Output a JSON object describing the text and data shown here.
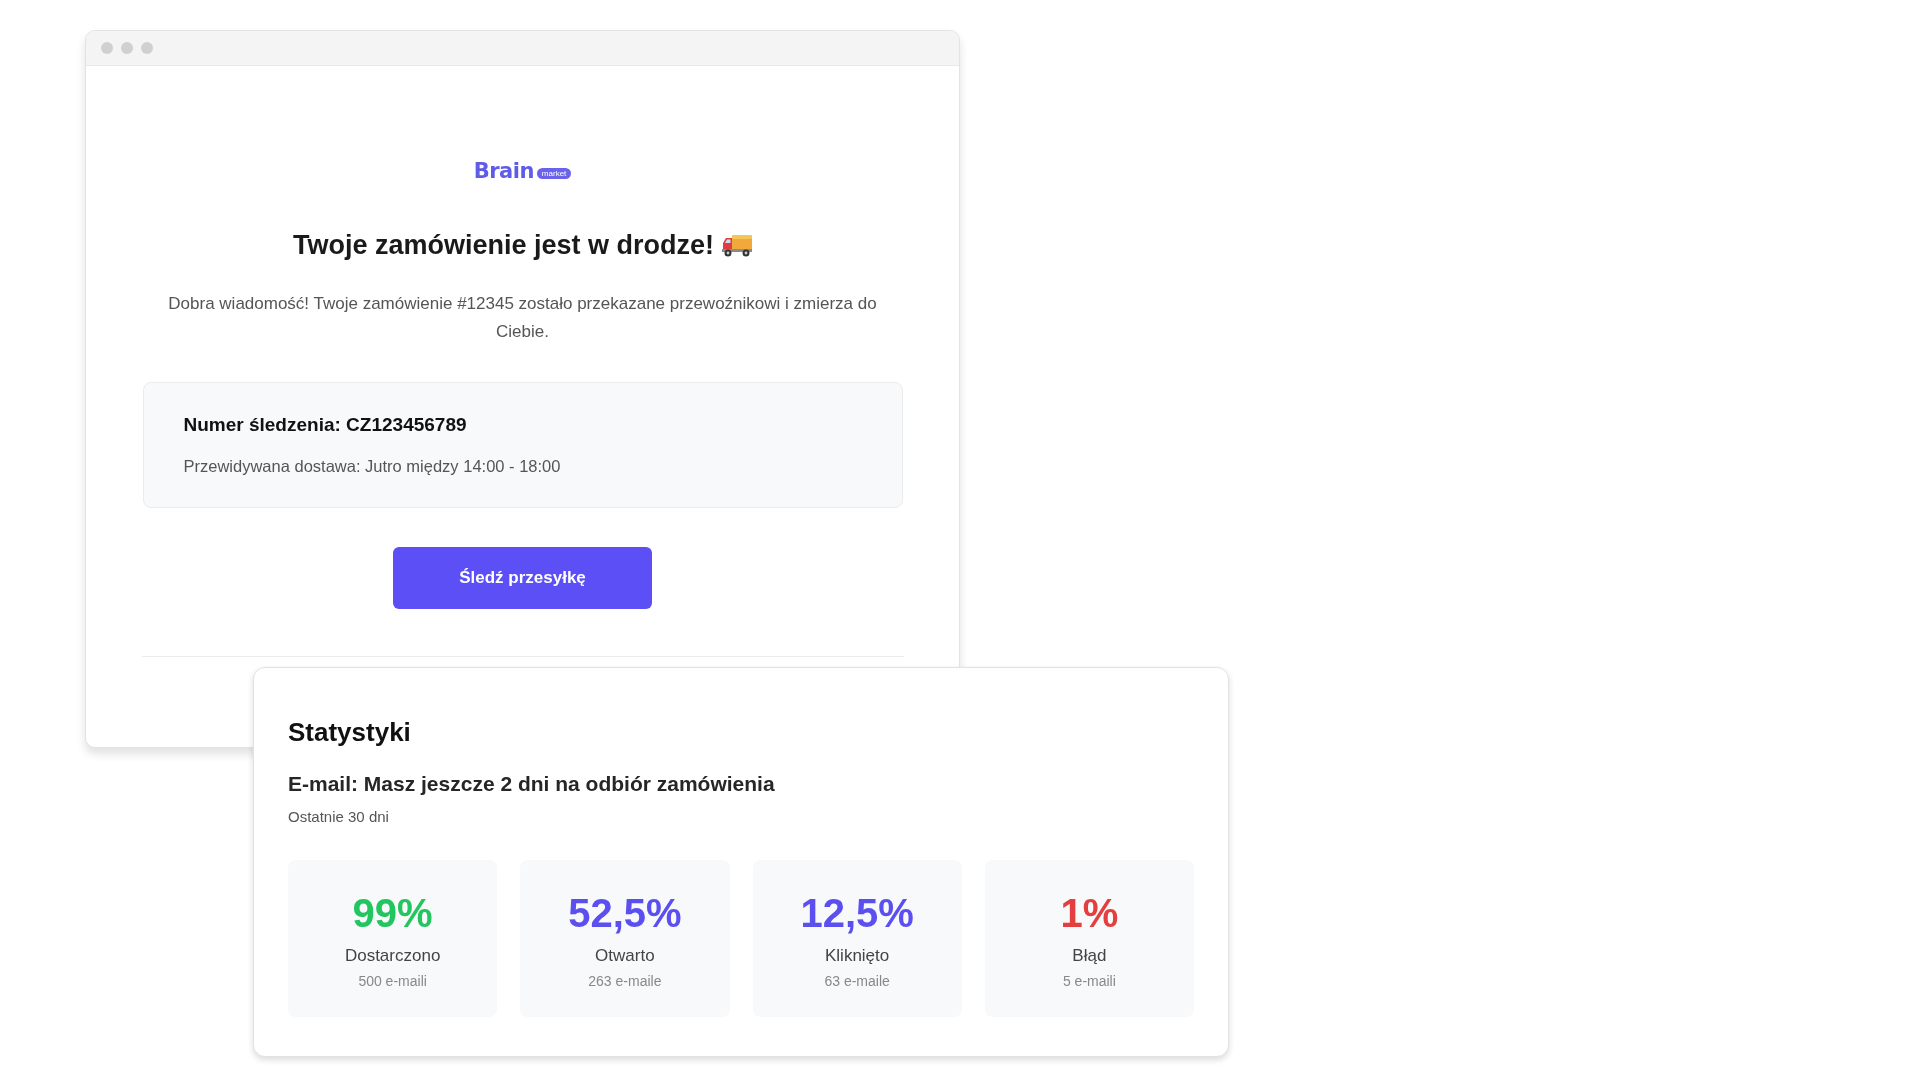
{
  "email": {
    "logo": {
      "name": "Brain",
      "tag": "market"
    },
    "heading": "Twoje zamówienie jest w drodze!",
    "intro": "Dobra wiadomość! Twoje zamówienie #12345 zostało przekazane przewoźnikowi i zmierza do Ciebie.",
    "tracking": {
      "number_line": "Numer śledzenia: CZ123456789",
      "delivery": "Przewidywana dostawa: Jutro między 14:00 - 18:00"
    },
    "button": "Śledź przesyłkę"
  },
  "stats": {
    "title": "Statystyki",
    "email_subject": "E-mail: Masz jeszcze 2 dni na odbiór zamówienia",
    "period": "Ostatnie 30 dni",
    "tiles": [
      {
        "value": "99%",
        "label": "Dostarczono",
        "count": "500 e-maili",
        "color": "#22c55e"
      },
      {
        "value": "52,5%",
        "label": "Otwarto",
        "count": "263 e-maile",
        "color": "#5b4ff0"
      },
      {
        "value": "12,5%",
        "label": "Kliknięto",
        "count": "63 e-maile",
        "color": "#5b4ff0"
      },
      {
        "value": "1%",
        "label": "Błąd",
        "count": "5 e-maili",
        "color": "#e53e3e"
      }
    ]
  }
}
